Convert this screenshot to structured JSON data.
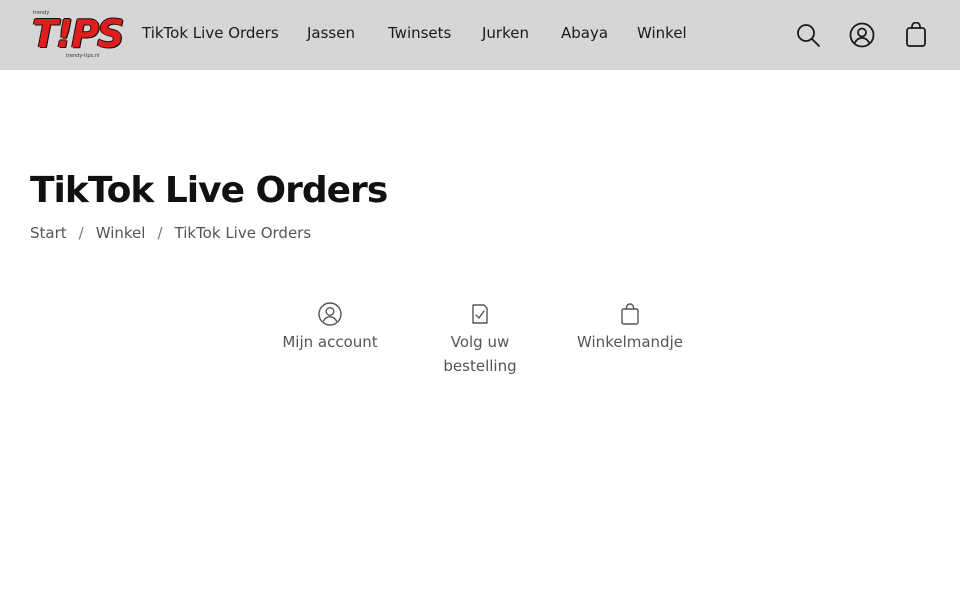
{
  "header": {
    "logo": {
      "tagline_top": "trendy",
      "main_text": "T!PS",
      "tagline_bottom": "trendy-tips.nl"
    },
    "nav": [
      {
        "label": "TikTok Live Orders"
      },
      {
        "label": "Jassen"
      },
      {
        "label": "Twinsets"
      },
      {
        "label": "Jurken"
      },
      {
        "label": "Abaya"
      },
      {
        "label": "Winkel"
      }
    ],
    "icons": {
      "search": "search-icon",
      "account": "user-circle-icon",
      "cart": "shopping-bag-icon"
    }
  },
  "page": {
    "title": "TikTok Live Orders",
    "breadcrumb": {
      "items": [
        "Start",
        "Winkel",
        "TikTok Live Orders"
      ],
      "separator": "/"
    }
  },
  "quick_links": [
    {
      "label": "Mijn account",
      "icon": "user-circle-icon"
    },
    {
      "label": "Volg uw\nbestelling",
      "icon": "checklist-icon"
    },
    {
      "label": "Winkelmandje",
      "icon": "shopping-bag-icon"
    }
  ],
  "colors": {
    "header_bg": "#d6d6d6",
    "logo_red": "#e01e1e",
    "text_dark": "#111111",
    "text_muted": "#555555"
  }
}
